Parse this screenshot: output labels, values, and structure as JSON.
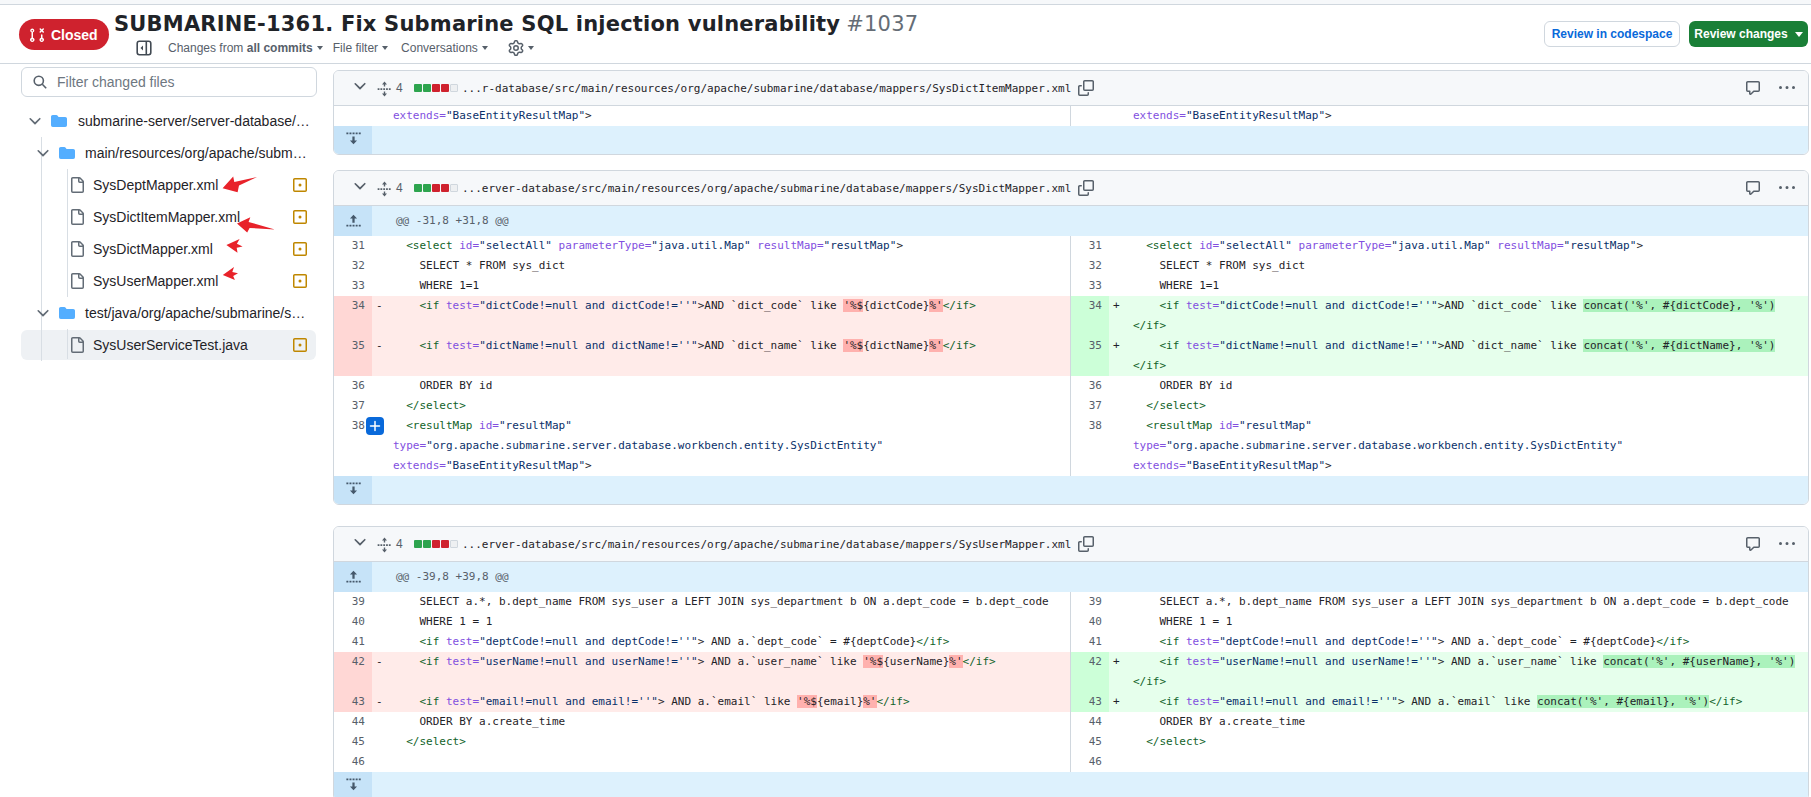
{
  "header": {
    "state": "Closed",
    "title": "SUBMARINE-1361. Fix Submarine SQL injection vulnerability",
    "number": "#1037",
    "toolbar": {
      "changes_from": "Changes from",
      "all_commits": "all commits",
      "file_filter": "File filter",
      "conversations": "Conversations"
    },
    "buttons": {
      "codespace": "Review in codespace",
      "review": "Review changes"
    }
  },
  "sidebar": {
    "filter_placeholder": "Filter changed files",
    "tree": [
      {
        "type": "folder",
        "depth": 0,
        "label": "submarine-server/server-database/…"
      },
      {
        "type": "folder",
        "depth": 1,
        "label": "main/resources/org/apache/subm…"
      },
      {
        "type": "file",
        "depth": 2,
        "label": "SysDeptMapper.xml",
        "status": "modified"
      },
      {
        "type": "file",
        "depth": 2,
        "label": "SysDictItemMapper.xml",
        "status": "modified"
      },
      {
        "type": "file",
        "depth": 2,
        "label": "SysDictMapper.xml",
        "status": "modified"
      },
      {
        "type": "file",
        "depth": 2,
        "label": "SysUserMapper.xml",
        "status": "modified"
      },
      {
        "type": "folder",
        "depth": 1,
        "label": "test/java/org/apache/submarine/s…"
      },
      {
        "type": "file",
        "depth": 2,
        "label": "SysUserServiceTest.java",
        "status": "modified",
        "selected": true
      }
    ]
  },
  "colors": {
    "closed_badge": "#cf222e",
    "review_button_green": "#1a7f37",
    "link_accent": "#0969da",
    "diffstat_addition": "#2da44e",
    "diffstat_deletion": "#cf222e",
    "annotation_arrow": "#e8222a"
  },
  "cards": [
    {
      "count": "4",
      "squares": [
        "add",
        "add",
        "del",
        "del",
        "empty"
      ],
      "path": "...r-database/src/main/resources/org/apache/submarine/database/mappers/SysDictItemMapper.xml",
      "hunk": null,
      "left": [
        {
          "t": "ctx",
          "segs": [
            [
              "a",
              "extends="
            ],
            [
              "s",
              "\"BaseEntityResultMap\""
            ],
            [
              "p",
              ">"
            ]
          ]
        }
      ],
      "right": [
        {
          "t": "ctx",
          "segs": [
            [
              "a",
              "extends="
            ],
            [
              "s",
              "\"BaseEntityResultMap\""
            ],
            [
              "p",
              ">"
            ]
          ]
        }
      ]
    },
    {
      "count": "4",
      "squares": [
        "add",
        "add",
        "del",
        "del",
        "empty"
      ],
      "path": "...erver-database/src/main/resources/org/apache/submarine/database/mappers/SysDictMapper.xml",
      "hunk": "@@ -31,8 +31,8 @@",
      "left": [
        {
          "n": "31",
          "t": "ctx",
          "segs": [
            [
              "p",
              "  "
            ],
            [
              "t",
              "<select"
            ],
            [
              "p",
              " "
            ],
            [
              "a",
              "id="
            ],
            [
              "s",
              "\"selectAll\""
            ],
            [
              "p",
              " "
            ],
            [
              "a",
              "parameterType="
            ],
            [
              "s",
              "\"java.util.Map\""
            ],
            [
              "p",
              " "
            ],
            [
              "a",
              "resultMap="
            ],
            [
              "s",
              "\"resultMap\""
            ],
            [
              "p",
              ">"
            ]
          ]
        },
        {
          "n": "32",
          "t": "ctx",
          "segs": [
            [
              "p",
              "    SELECT * FROM sys_dict"
            ]
          ]
        },
        {
          "n": "33",
          "t": "ctx",
          "segs": [
            [
              "p",
              "    WHERE 1=1"
            ]
          ]
        },
        {
          "n": "34",
          "t": "del",
          "m": "-",
          "segs": [
            [
              "p",
              "    "
            ],
            [
              "t",
              "<if"
            ],
            [
              "p",
              " "
            ],
            [
              "a",
              "test="
            ],
            [
              "s",
              "\"dictCode!=null and dictCode!=''\""
            ],
            [
              "p",
              ">AND `dict_code` like "
            ],
            [
              "d",
              "'%$"
            ],
            [
              "p",
              "{dictCode}"
            ],
            [
              "d",
              "%'"
            ],
            [
              "t",
              "</if>"
            ]
          ]
        },
        {
          "t": "del",
          "segs": []
        },
        {
          "n": "35",
          "t": "del",
          "m": "-",
          "segs": [
            [
              "p",
              "    "
            ],
            [
              "t",
              "<if"
            ],
            [
              "p",
              " "
            ],
            [
              "a",
              "test="
            ],
            [
              "s",
              "\"dictName!=null and dictName!=''\""
            ],
            [
              "p",
              ">AND `dict_name` like "
            ],
            [
              "d",
              "'%$"
            ],
            [
              "p",
              "{dictName}"
            ],
            [
              "d",
              "%'"
            ],
            [
              "t",
              "</if>"
            ]
          ]
        },
        {
          "t": "del",
          "segs": []
        },
        {
          "n": "36",
          "t": "ctx",
          "segs": [
            [
              "p",
              "    ORDER BY id"
            ]
          ]
        },
        {
          "n": "37",
          "t": "ctx",
          "segs": [
            [
              "p",
              "  "
            ],
            [
              "t",
              "</select>"
            ]
          ]
        },
        {
          "n": "38",
          "t": "ctx",
          "plus": true,
          "segs": [
            [
              "p",
              "  "
            ],
            [
              "t",
              "<resultMap"
            ],
            [
              "p",
              " "
            ],
            [
              "a",
              "id="
            ],
            [
              "s",
              "\"resultMap\""
            ]
          ]
        },
        {
          "t": "ctx",
          "segs": [
            [
              "a",
              "type="
            ],
            [
              "s",
              "\"org.apache.submarine.server.database.workbench.entity.SysDictEntity\""
            ]
          ]
        },
        {
          "t": "ctx",
          "segs": [
            [
              "a",
              "extends="
            ],
            [
              "s",
              "\"BaseEntityResultMap\""
            ],
            [
              "p",
              ">"
            ]
          ]
        }
      ],
      "right": [
        {
          "n": "31",
          "t": "ctx",
          "segs": [
            [
              "p",
              "  "
            ],
            [
              "t",
              "<select"
            ],
            [
              "p",
              " "
            ],
            [
              "a",
              "id="
            ],
            [
              "s",
              "\"selectAll\""
            ],
            [
              "p",
              " "
            ],
            [
              "a",
              "parameterType="
            ],
            [
              "s",
              "\"java.util.Map\""
            ],
            [
              "p",
              " "
            ],
            [
              "a",
              "resultMap="
            ],
            [
              "s",
              "\"resultMap\""
            ],
            [
              "p",
              ">"
            ]
          ]
        },
        {
          "n": "32",
          "t": "ctx",
          "segs": [
            [
              "p",
              "    SELECT * FROM sys_dict"
            ]
          ]
        },
        {
          "n": "33",
          "t": "ctx",
          "segs": [
            [
              "p",
              "    WHERE 1=1"
            ]
          ]
        },
        {
          "n": "34",
          "t": "add",
          "m": "+",
          "segs": [
            [
              "p",
              "    "
            ],
            [
              "t",
              "<if"
            ],
            [
              "p",
              " "
            ],
            [
              "a",
              "test="
            ],
            [
              "s",
              "\"dictCode!=null and dictCode!=''\""
            ],
            [
              "p",
              ">AND `dict_code` like "
            ],
            [
              "g",
              "concat('%', #{dictCode}, '%')"
            ]
          ]
        },
        {
          "t": "add",
          "segs": [
            [
              "t",
              "</if>"
            ]
          ]
        },
        {
          "n": "35",
          "t": "add",
          "m": "+",
          "segs": [
            [
              "p",
              "    "
            ],
            [
              "t",
              "<if"
            ],
            [
              "p",
              " "
            ],
            [
              "a",
              "test="
            ],
            [
              "s",
              "\"dictName!=null and dictName!=''\""
            ],
            [
              "p",
              ">AND `dict_name` like "
            ],
            [
              "g",
              "concat('%', #{dictName}, '%')"
            ]
          ]
        },
        {
          "t": "add",
          "segs": [
            [
              "t",
              "</if>"
            ]
          ]
        },
        {
          "n": "36",
          "t": "ctx",
          "segs": [
            [
              "p",
              "    ORDER BY id"
            ]
          ]
        },
        {
          "n": "37",
          "t": "ctx",
          "segs": [
            [
              "p",
              "  "
            ],
            [
              "t",
              "</select>"
            ]
          ]
        },
        {
          "n": "38",
          "t": "ctx",
          "segs": [
            [
              "p",
              "  "
            ],
            [
              "t",
              "<resultMap"
            ],
            [
              "p",
              " "
            ],
            [
              "a",
              "id="
            ],
            [
              "s",
              "\"resultMap\""
            ]
          ]
        },
        {
          "t": "ctx",
          "segs": [
            [
              "a",
              "type="
            ],
            [
              "s",
              "\"org.apache.submarine.server.database.workbench.entity.SysDictEntity\""
            ]
          ]
        },
        {
          "t": "ctx",
          "segs": [
            [
              "a",
              "extends="
            ],
            [
              "s",
              "\"BaseEntityResultMap\""
            ],
            [
              "p",
              ">"
            ]
          ]
        }
      ]
    },
    {
      "count": "4",
      "squares": [
        "add",
        "add",
        "del",
        "del",
        "empty"
      ],
      "path": "...erver-database/src/main/resources/org/apache/submarine/database/mappers/SysUserMapper.xml",
      "hunk": "@@ -39,8 +39,8 @@",
      "left": [
        {
          "n": "39",
          "t": "ctx",
          "segs": [
            [
              "p",
              "    SELECT a.*, b.dept_name FROM sys_user a LEFT JOIN sys_department b ON a.dept_code = b.dept_code"
            ]
          ]
        },
        {
          "n": "40",
          "t": "ctx",
          "segs": [
            [
              "p",
              "    WHERE 1 = 1"
            ]
          ]
        },
        {
          "n": "41",
          "t": "ctx",
          "segs": [
            [
              "p",
              "    "
            ],
            [
              "t",
              "<if"
            ],
            [
              "p",
              " "
            ],
            [
              "a",
              "test="
            ],
            [
              "s",
              "\"deptCode!=null and deptCode!=''\""
            ],
            [
              "p",
              "> AND a.`dept_code` = #{deptCode}"
            ],
            [
              "t",
              "</if>"
            ]
          ]
        },
        {
          "n": "42",
          "t": "del",
          "m": "-",
          "segs": [
            [
              "p",
              "    "
            ],
            [
              "t",
              "<if"
            ],
            [
              "p",
              " "
            ],
            [
              "a",
              "test="
            ],
            [
              "s",
              "\"userName!=null and userName!=''\""
            ],
            [
              "p",
              "> AND a.`user_name` like "
            ],
            [
              "d",
              "'%$"
            ],
            [
              "p",
              "{userName}"
            ],
            [
              "d",
              "%'"
            ],
            [
              "t",
              "</if>"
            ]
          ]
        },
        {
          "t": "del",
          "segs": []
        },
        {
          "n": "43",
          "t": "del",
          "m": "-",
          "segs": [
            [
              "p",
              "    "
            ],
            [
              "t",
              "<if"
            ],
            [
              "p",
              " "
            ],
            [
              "a",
              "test="
            ],
            [
              "s",
              "\"email!=null and email!=''\""
            ],
            [
              "p",
              "> AND a.`email` like "
            ],
            [
              "d",
              "'%$"
            ],
            [
              "p",
              "{email}"
            ],
            [
              "d",
              "%'"
            ],
            [
              "t",
              "</if>"
            ]
          ]
        },
        {
          "n": "44",
          "t": "ctx",
          "segs": [
            [
              "p",
              "    ORDER BY a.create_time"
            ]
          ]
        },
        {
          "n": "45",
          "t": "ctx",
          "segs": [
            [
              "p",
              "  "
            ],
            [
              "t",
              "</select>"
            ]
          ]
        },
        {
          "n": "46",
          "t": "ctx",
          "segs": []
        }
      ],
      "right": [
        {
          "n": "39",
          "t": "ctx",
          "segs": [
            [
              "p",
              "    SELECT a.*, b.dept_name FROM sys_user a LEFT JOIN sys_department b ON a.dept_code = b.dept_code"
            ]
          ]
        },
        {
          "n": "40",
          "t": "ctx",
          "segs": [
            [
              "p",
              "    WHERE 1 = 1"
            ]
          ]
        },
        {
          "n": "41",
          "t": "ctx",
          "segs": [
            [
              "p",
              "    "
            ],
            [
              "t",
              "<if"
            ],
            [
              "p",
              " "
            ],
            [
              "a",
              "test="
            ],
            [
              "s",
              "\"deptCode!=null and deptCode!=''\""
            ],
            [
              "p",
              "> AND a.`dept_code` = #{deptCode}"
            ],
            [
              "t",
              "</if>"
            ]
          ]
        },
        {
          "n": "42",
          "t": "add",
          "m": "+",
          "segs": [
            [
              "p",
              "    "
            ],
            [
              "t",
              "<if"
            ],
            [
              "p",
              " "
            ],
            [
              "a",
              "test="
            ],
            [
              "s",
              "\"userName!=null and userName!=''\""
            ],
            [
              "p",
              "> AND a.`user_name` like "
            ],
            [
              "g",
              "concat('%', #{userName}, '%')"
            ]
          ]
        },
        {
          "t": "add",
          "segs": [
            [
              "t",
              "</if>"
            ]
          ]
        },
        {
          "n": "43",
          "t": "add",
          "m": "+",
          "segs": [
            [
              "p",
              "    "
            ],
            [
              "t",
              "<if"
            ],
            [
              "p",
              " "
            ],
            [
              "a",
              "test="
            ],
            [
              "s",
              "\"email!=null and email!=''\""
            ],
            [
              "p",
              "> AND a.`email` like "
            ],
            [
              "g",
              "concat('%', #{email}, '%')"
            ],
            [
              "t",
              "</if>"
            ]
          ]
        },
        {
          "n": "44",
          "t": "ctx",
          "segs": [
            [
              "p",
              "    ORDER BY a.create_time"
            ]
          ]
        },
        {
          "n": "45",
          "t": "ctx",
          "segs": [
            [
              "p",
              "  "
            ],
            [
              "t",
              "</select>"
            ]
          ]
        },
        {
          "n": "46",
          "t": "ctx",
          "segs": []
        }
      ]
    }
  ]
}
